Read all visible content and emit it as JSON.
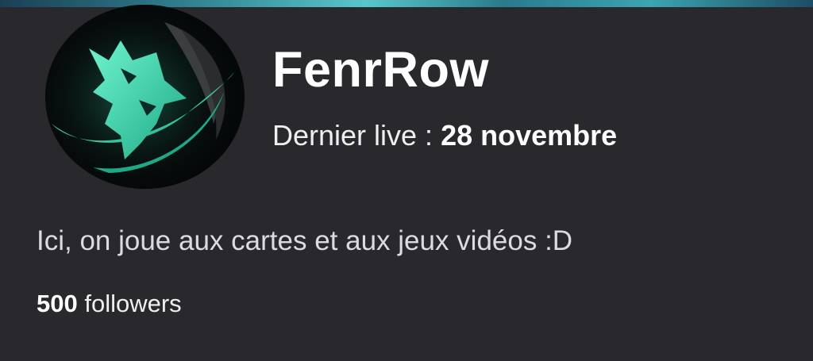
{
  "channel": {
    "name": "FenrRow",
    "avatar_icon": "wolf-logo-icon",
    "accent_color": "#3fe0b5"
  },
  "last_live": {
    "label": "Dernier live :",
    "date": "28 novembre"
  },
  "description": "Ici, on joue aux cartes et aux jeux vidéos :D",
  "followers": {
    "count": "500",
    "label": "followers"
  }
}
